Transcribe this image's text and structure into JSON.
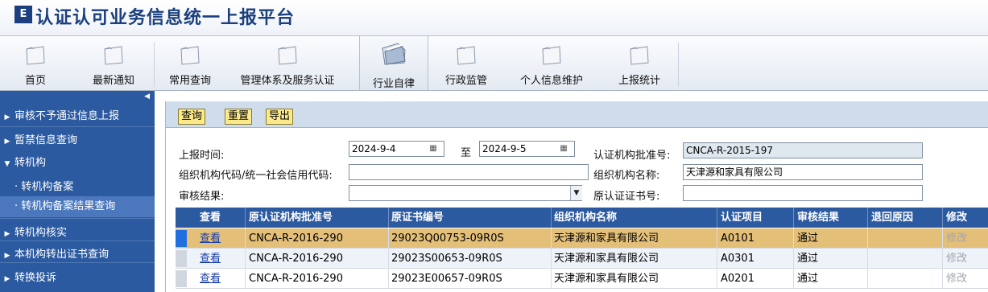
{
  "app": {
    "logo": "E",
    "title": "认证认可业务信息统一上报平台"
  },
  "nav": [
    {
      "label": "首页"
    },
    {
      "label": "最新通知"
    },
    {
      "label": "常用查询"
    },
    {
      "label": "管理体系及服务认证"
    },
    {
      "label": "行业自律",
      "active": true
    },
    {
      "label": "行政监管"
    },
    {
      "label": "个人信息维护"
    },
    {
      "label": "上报统计"
    }
  ],
  "sidebar": {
    "collapse": "◀",
    "items": [
      {
        "label": "审核不予通过信息上报",
        "arrow": "▶"
      },
      {
        "label": "暂禁信息查询",
        "arrow": "▶"
      },
      {
        "label": "转机构",
        "arrow": "▼"
      },
      {
        "label": "· 转机构备案"
      },
      {
        "label": "· 转机构备案结果查询",
        "selected": true
      },
      {
        "label": "转机构核实",
        "arrow": "▶"
      },
      {
        "label": "本机构转出证书查询",
        "arrow": "▶"
      },
      {
        "label": "转换投诉",
        "arrow": "▶"
      }
    ]
  },
  "toolbar": {
    "query": "查询",
    "reset": "重置",
    "export": "导出"
  },
  "form": {
    "report_time_label": "上报时间:",
    "date_from": "2024-9-4",
    "to_label": "至",
    "date_to": "2024-9-5",
    "approval_no_label": "认证机构批准号:",
    "approval_no": "CNCA-R-2015-197",
    "org_code_label": "组织机构代码/统一社会信用代码:",
    "org_code": "",
    "org_name_label": "组织机构名称:",
    "org_name": "天津源和家具有限公司",
    "audit_result_label": "审核结果:",
    "audit_result": "",
    "orig_cert_label": "原认证证书号:",
    "orig_cert": ""
  },
  "table": {
    "headers": [
      "查看",
      "原认证机构批准号",
      "原证书编号",
      "组织机构名称",
      "认证项目",
      "审核结果",
      "退回原因",
      "修改"
    ],
    "rows": [
      {
        "view": "查看",
        "approval": "CNCA-R-2016-290",
        "cert": "29023Q00753-09R0S",
        "org": "天津源和家具有限公司",
        "project": "A0101",
        "result": "通过",
        "reason": "",
        "edit": "修改",
        "selected": true
      },
      {
        "view": "查看",
        "approval": "CNCA-R-2016-290",
        "cert": "29023S00653-09R0S",
        "org": "天津源和家具有限公司",
        "project": "A0301",
        "result": "通过",
        "reason": "",
        "edit": "修改"
      },
      {
        "view": "查看",
        "approval": "CNCA-R-2016-290",
        "cert": "29023E00657-09R0S",
        "org": "天津源和家具有限公司",
        "project": "A0201",
        "result": "通过",
        "reason": "",
        "edit": "修改"
      }
    ]
  },
  "colors": {
    "sidebar": "#2c5aa0",
    "selected_row": "#e4bf78",
    "button": "#fbe98a"
  }
}
